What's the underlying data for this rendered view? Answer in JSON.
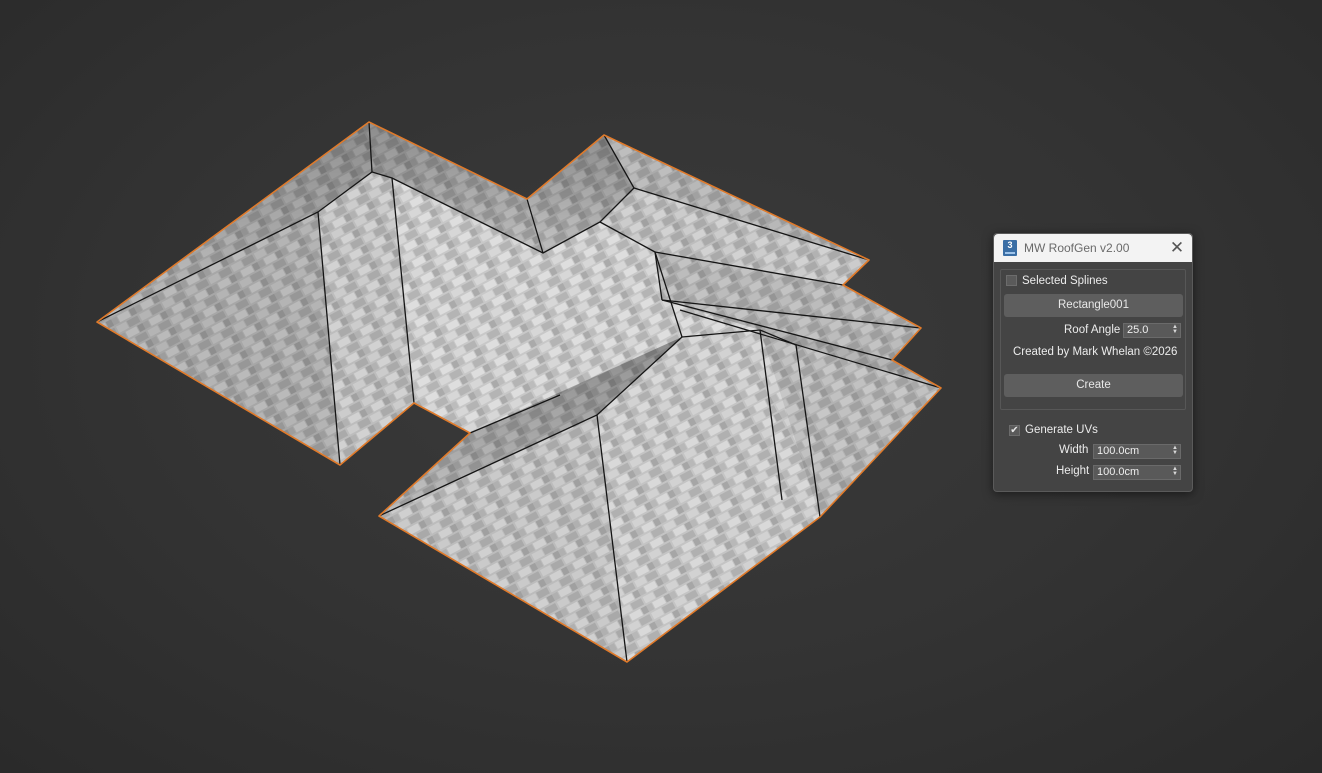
{
  "dialog": {
    "title": "MW RoofGen v2.00",
    "app_icon_label": "3",
    "close_glyph": "✕",
    "selected_splines": {
      "label": "Selected Splines",
      "checked": false
    },
    "spline_button_label": "Rectangle001",
    "roof_angle": {
      "label": "Roof Angle",
      "value": "25.0"
    },
    "credit": "Created by Mark Whelan ©2026",
    "create_button_label": "Create",
    "generate_uvs": {
      "label": "Generate UVs",
      "checked": true,
      "check_glyph": "✔"
    },
    "width": {
      "label": "Width",
      "value": "100.0cm"
    },
    "height": {
      "label": "Height",
      "value": "100.0cm"
    },
    "spinner_glyph": "▲▼"
  },
  "viewport": {
    "object": "roof-mesh",
    "colors": {
      "background": "#333333",
      "selection_outline": "#e07a2a",
      "roof_tile_light": "#cfcfcf",
      "roof_tile_dark": "#a9a9a9",
      "edge_line": "#151515"
    }
  }
}
